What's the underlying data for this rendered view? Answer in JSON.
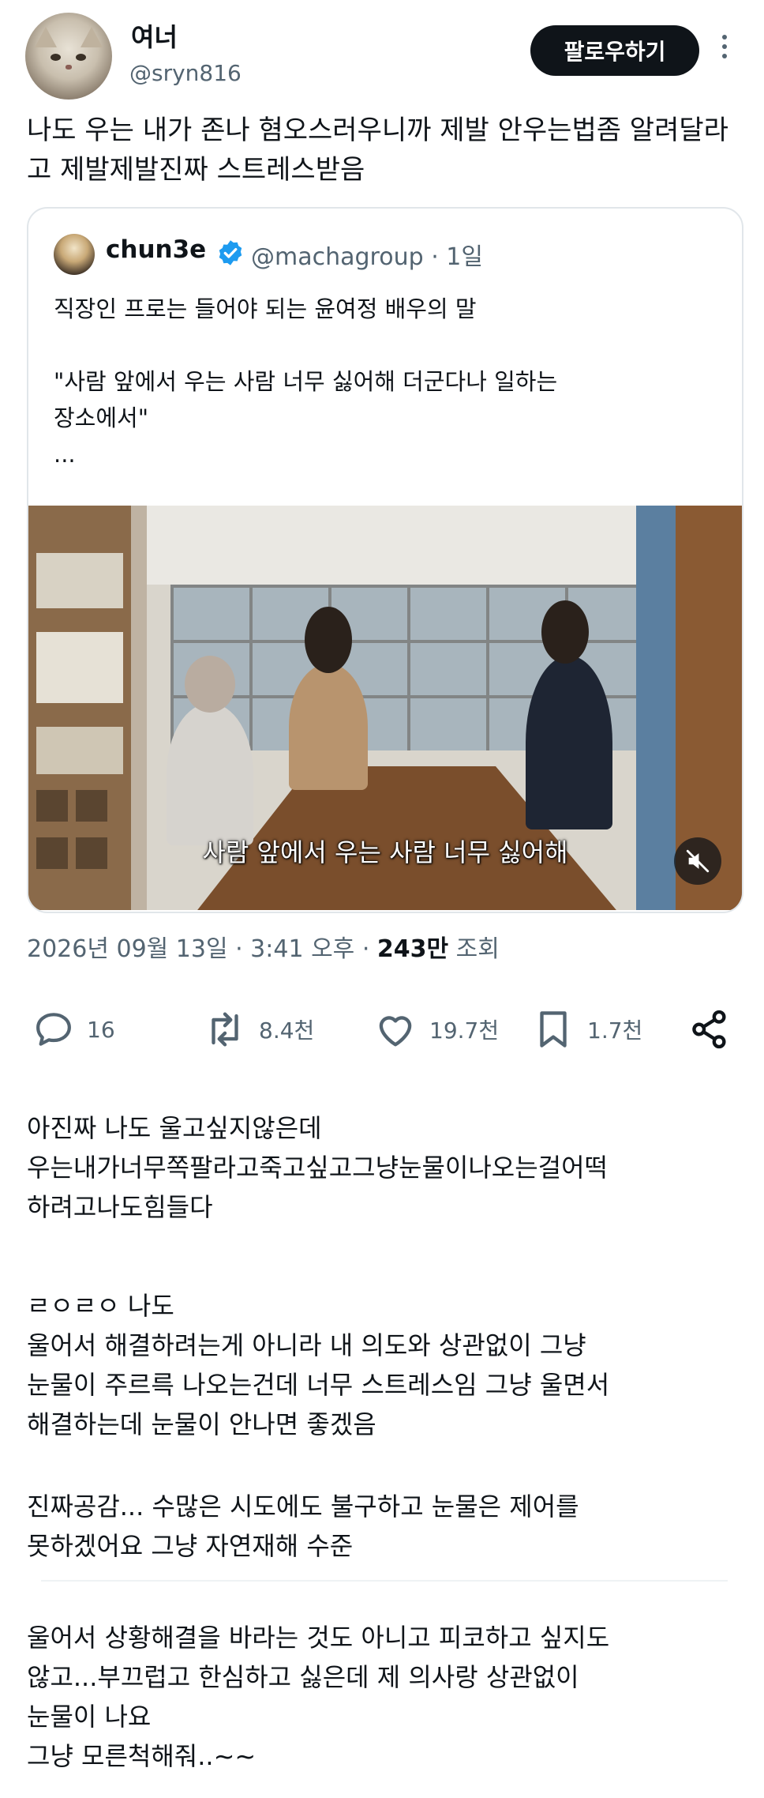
{
  "tweet": {
    "author": {
      "display_name": "여너",
      "handle": "@sryn816"
    },
    "follow_label": "팔로우하기",
    "text": "나도 우는 내가 존나 혐오스러우니까 제발 안우는법좀 알려달라고 제발제발진짜 스트레스받음"
  },
  "quote": {
    "author": {
      "display_name": "chun3e",
      "handle": "@machagroup",
      "time": "· 1일"
    },
    "lines": [
      "직장인 프로는 들어야 되는 윤여정 배우의 말",
      "",
      "\"사람 앞에서 우는 사람 너무 싫어해 더군다나 일하는",
      "장소에서\"",
      "..."
    ],
    "video_caption": "사람 앞에서 우는 사람 너무 싫어해"
  },
  "meta": {
    "date_time": "2026년 09월 13일 · 3:41 오후 · ",
    "views_count": "243만",
    "views_label": " 조회"
  },
  "actions": {
    "replies": "16",
    "reposts": "8.4천",
    "likes": "19.7천",
    "bookmarks": "1.7천"
  },
  "replies": [
    {
      "lines": [
        "아진짜 나도 울고싶지않은데",
        "우는내가너무쪽팔라고죽고싶고그냥눈물이나오는걸어떡",
        "하려고나도힘들다"
      ]
    },
    {
      "lines": [
        "ㄹㅇㄹㅇ 나도",
        "울어서 해결하려는게 아니라 내 의도와 상관없이 그냥",
        "눈물이 주르륵 나오는건데 너무 스트레스임 그냥 울면서",
        "해결하는데 눈물이 안나면 좋겠음"
      ]
    },
    {
      "lines": [
        "진짜공감... 수많은 시도에도 불구하고 눈물은 제어를",
        "못하겠어요 그냥 자연재해 수준"
      ]
    },
    {
      "lines": [
        "울어서 상황해결을 바라는 것도 아니고 피코하고 싶지도",
        "않고...부끄럽고 한심하고 싫은데 제 의사랑 상관없이",
        "눈물이 나요",
        "그냥 모른척해줘..~~"
      ]
    }
  ],
  "colors": {
    "text": "#0f1419",
    "secondary": "#536471",
    "verified": "#1d9bf0",
    "border": "#e1e6ea"
  }
}
